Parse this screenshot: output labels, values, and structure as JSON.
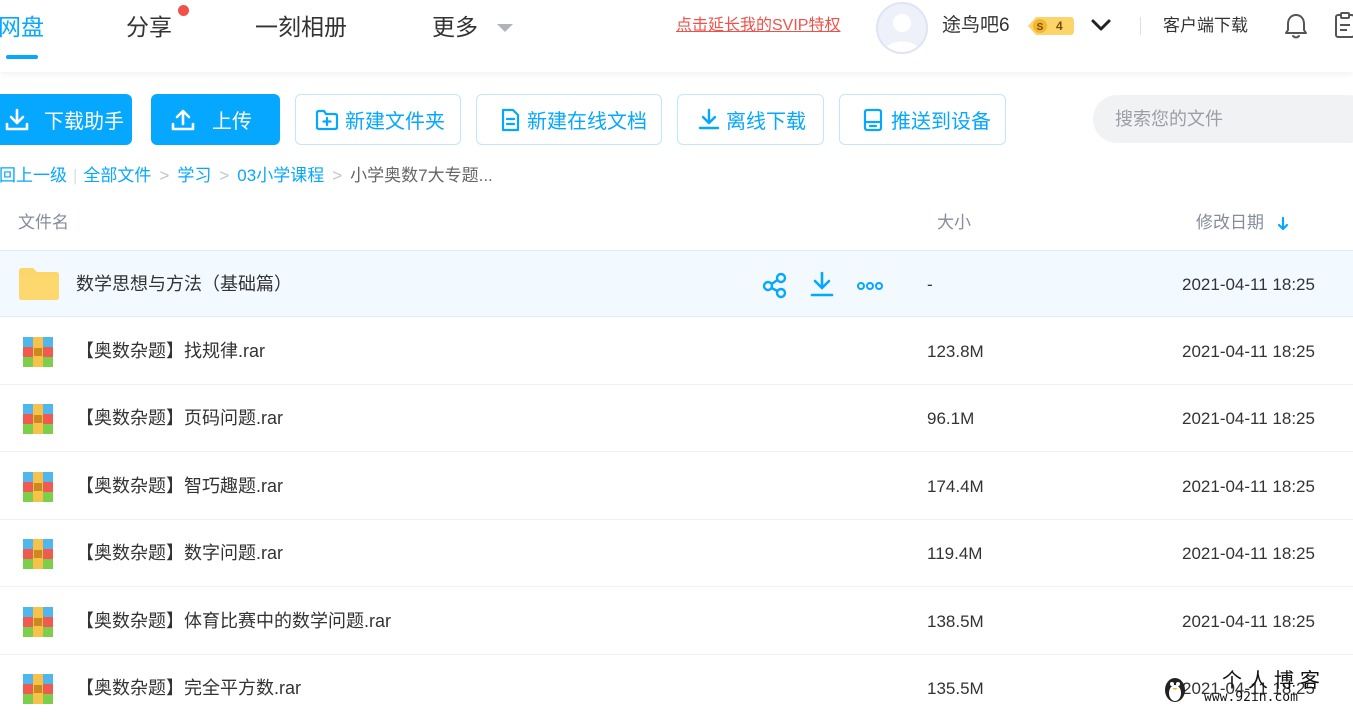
{
  "topnav": {
    "tabs": [
      {
        "label": "网盘",
        "active": true
      },
      {
        "label": "分享",
        "has_dot": true
      },
      {
        "label": "一刻相册"
      },
      {
        "label": "更多"
      }
    ],
    "svip_link": "点击延长我的SVIP特权",
    "username": "途鸟吧6",
    "vip_level": "4",
    "client_download": "客户端下载"
  },
  "toolbar": {
    "download_helper": "下载助手",
    "upload": "上传",
    "new_folder": "新建文件夹",
    "new_online_doc": "新建在线文档",
    "offline_download": "离线下载",
    "push_to_device": "推送到设备",
    "search_placeholder": "搜索您的文件"
  },
  "breadcrumb": {
    "back": "返回上一级",
    "items": [
      "全部文件",
      "学习",
      "03小学课程"
    ],
    "current": "小学奥数7大专题..."
  },
  "table": {
    "headers": {
      "name": "文件名",
      "size": "大小",
      "modified": "修改日期"
    },
    "rows": [
      {
        "name": "数学思想与方法（基础篇）",
        "size": "-",
        "modified": "2021-04-11 18:25",
        "type": "folder"
      },
      {
        "name": "【奥数杂题】找规律.rar",
        "size": "123.8M",
        "modified": "2021-04-11 18:25",
        "type": "rar"
      },
      {
        "name": "【奥数杂题】页码问题.rar",
        "size": "96.1M",
        "modified": "2021-04-11 18:25",
        "type": "rar"
      },
      {
        "name": "【奥数杂题】智巧趣题.rar",
        "size": "174.4M",
        "modified": "2021-04-11 18:25",
        "type": "rar"
      },
      {
        "name": "【奥数杂题】数字问题.rar",
        "size": "119.4M",
        "modified": "2021-04-11 18:25",
        "type": "rar"
      },
      {
        "name": "【奥数杂题】体育比赛中的数学问题.rar",
        "size": "138.5M",
        "modified": "2021-04-11 18:25",
        "type": "rar"
      },
      {
        "name": "【奥数杂题】完全平方数.rar",
        "size": "135.5M",
        "modified": "2021-04-11 18:25",
        "type": "rar"
      }
    ]
  },
  "watermark": {
    "title": "个人博客",
    "url": "www.92in.com"
  },
  "colors": {
    "accent": "#06a7ff",
    "danger": "#f0524a",
    "folder": "#fcd66a"
  }
}
